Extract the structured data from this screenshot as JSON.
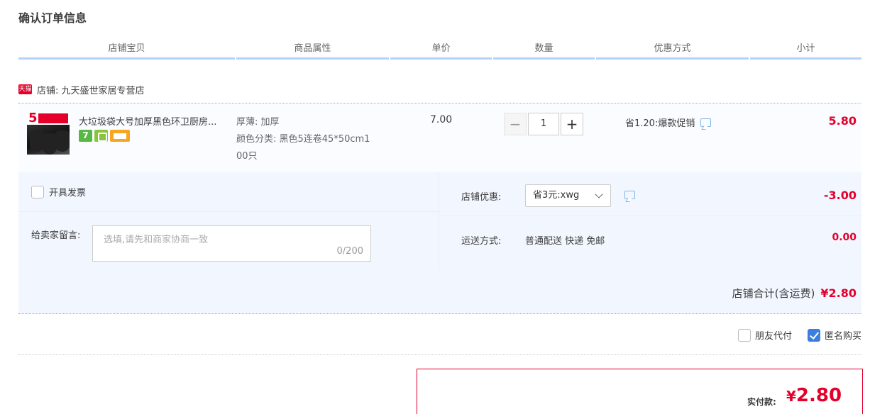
{
  "page": {
    "title": "确认订单信息"
  },
  "columns": [
    "店铺宝贝",
    "商品属性",
    "单价",
    "数量",
    "优惠方式",
    "小计"
  ],
  "shop": {
    "badge": "天猫",
    "name": "店铺: 九天盛世家居专营店"
  },
  "item": {
    "thumb_badge": "5",
    "title": "大垃圾袋大号加厚黑色环卫厨房...",
    "service_seven": "7",
    "attr_thickness": "厚薄: 加厚",
    "attr_color_1": "颜色分类: 黑色5连卷45*50cm1",
    "attr_color_2": "00只",
    "unit_price": "7.00",
    "qty_minus": "−",
    "qty": "1",
    "qty_plus": "+",
    "promo": "省1.20:爆款促销",
    "subtotal": "5.80"
  },
  "invoice": {
    "label": "开具发票"
  },
  "message": {
    "label": "给卖家留言:",
    "placeholder": "选填,请先和商家协商一致",
    "count": "0/200"
  },
  "shop_discount": {
    "label": "店铺优惠:",
    "selected": "省3元:xwg",
    "amount": "-3.00"
  },
  "shipping": {
    "label": "运送方式:",
    "value": "普通配送 快递 免邮",
    "amount": "0.00"
  },
  "shop_total": {
    "label": "店铺合计(含运费)",
    "amount": "¥2.80"
  },
  "options": {
    "friend_pay": "朋友代付",
    "anonymous": "匿名购买",
    "anonymous_checked": true
  },
  "payment": {
    "label": "实付款:",
    "currency": "¥",
    "amount": "2.80"
  },
  "colors": {
    "accent_red": "#e4002b",
    "header_blue": "#b2d1ff",
    "panel_bg": "#f2f7ff"
  }
}
